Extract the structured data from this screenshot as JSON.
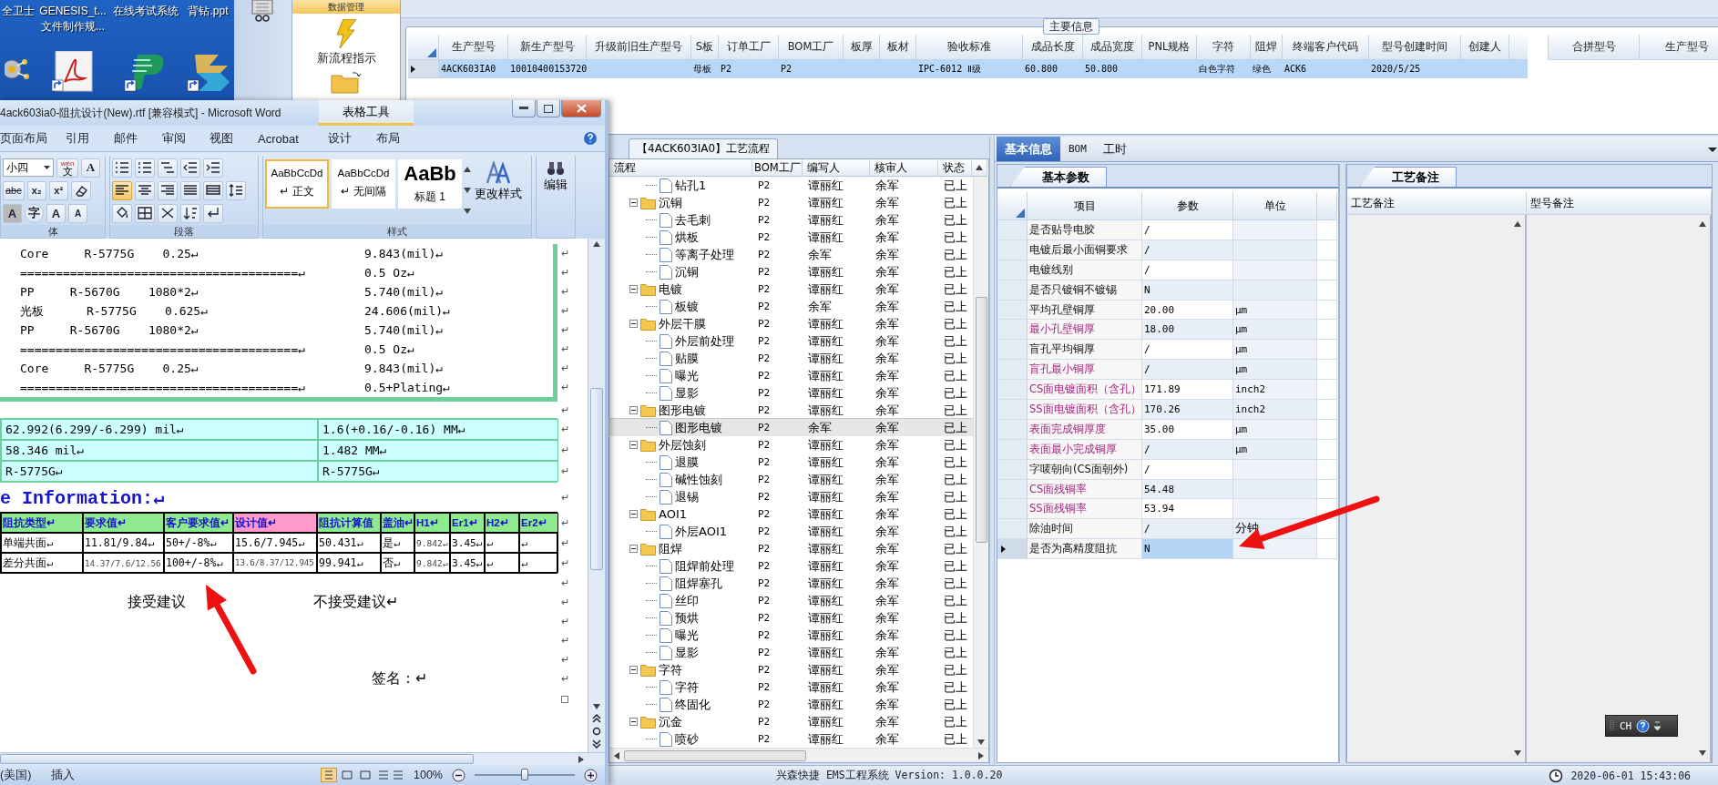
{
  "desktop": {
    "icons": [
      {
        "label_lines": [
          "全卫士"
        ],
        "kind": "gear"
      },
      {
        "label_lines": [
          "GENESIS_t...",
          "文件制作规..."
        ],
        "kind": "pdf"
      },
      {
        "label_lines": [
          "在线考试系统"
        ],
        "kind": "p"
      },
      {
        "label_lines": [
          "背钻.ppt"
        ],
        "kind": "chevrons"
      }
    ]
  },
  "app": {
    "nav": {
      "header": "数据管理",
      "items": [
        {
          "kind": "lightning",
          "label": "新流程指示"
        },
        {
          "kind": "folder"
        }
      ]
    },
    "main_info": {
      "title": "主要信息",
      "columns": [
        "生产型号",
        "新生产型号",
        "升级前旧生产型号",
        "S板",
        "订单工厂",
        "BOM工厂",
        "板厚",
        "板材",
        "验收标准",
        "成品长度",
        "成品宽度",
        "PNL规格",
        "字符",
        "阻焊",
        "终端客户代码",
        "型号创建时间",
        "创建人"
      ],
      "rows": [
        {
          "selected": true,
          "cells": [
            "4ACK603IA0",
            "10010400153720",
            null,
            "母板",
            "P2",
            "P2",
            null,
            null,
            "IPC-6012 Ⅱ级",
            "60.800",
            "50.800",
            null,
            "白色字符",
            "绿色",
            "ACK6",
            "2020/5/25",
            null
          ]
        }
      ],
      "side_columns": [
        "合拼型号",
        "生产型号"
      ]
    },
    "process": {
      "tab": "【4ACK603IA0】工艺流程",
      "columns": [
        "流程",
        "BOM工厂",
        "编写人",
        "核审人",
        "状态"
      ],
      "tree": [
        {
          "name": "钻孔1",
          "bom": "P2",
          "author": "谭丽红",
          "reviewer": "余军",
          "status": "已上",
          "selected": false
        },
        {
          "name": "沉铜",
          "bom": "P2",
          "author": "谭丽红",
          "reviewer": "余军",
          "status": "已上",
          "selected": false,
          "expanded": true,
          "children": [
            {
              "name": "去毛刺",
              "bom": "P2",
              "author": "谭丽红",
              "reviewer": "余军",
              "status": "已上",
              "selected": false
            },
            {
              "name": "烘板",
              "bom": "P2",
              "author": "谭丽红",
              "reviewer": "余军",
              "status": "已上",
              "selected": false
            },
            {
              "name": "等离子处理",
              "bom": "P2",
              "author": "余军",
              "reviewer": "余军",
              "status": "已上",
              "selected": false
            },
            {
              "name": "沉铜",
              "bom": "P2",
              "author": "谭丽红",
              "reviewer": "余军",
              "status": "已上",
              "selected": false
            }
          ]
        },
        {
          "name": "电镀",
          "bom": "P2",
          "author": "谭丽红",
          "reviewer": "余军",
          "status": "已上",
          "selected": false,
          "expanded": true,
          "children": [
            {
              "name": "板镀",
              "bom": "P2",
              "author": "余军",
              "reviewer": "余军",
              "status": "已上",
              "selected": false
            }
          ]
        },
        {
          "name": "外层干膜",
          "bom": "P2",
          "author": "谭丽红",
          "reviewer": "余军",
          "status": "已上",
          "selected": false,
          "expanded": true,
          "children": [
            {
              "name": "外层前处理",
              "bom": "P2",
              "author": "谭丽红",
              "reviewer": "余军",
              "status": "已上",
              "selected": false
            },
            {
              "name": "贴膜",
              "bom": "P2",
              "author": "谭丽红",
              "reviewer": "余军",
              "status": "已上",
              "selected": false
            },
            {
              "name": "曝光",
              "bom": "P2",
              "author": "谭丽红",
              "reviewer": "余军",
              "status": "已上",
              "selected": false
            },
            {
              "name": "显影",
              "bom": "P2",
              "author": "谭丽红",
              "reviewer": "余军",
              "status": "已上",
              "selected": false
            }
          ]
        },
        {
          "name": "图形电镀",
          "bom": "P2",
          "author": "谭丽红",
          "reviewer": "余军",
          "status": "已上",
          "selected": false,
          "expanded": true,
          "children": [
            {
              "name": "图形电镀",
              "bom": "P2",
              "author": "余军",
              "reviewer": "余军",
              "status": "已上",
              "selected": true
            }
          ]
        },
        {
          "name": "外层蚀刻",
          "bom": "P2",
          "author": "谭丽红",
          "reviewer": "余军",
          "status": "已上",
          "selected": false,
          "expanded": true,
          "children": [
            {
              "name": "退膜",
              "bom": "P2",
              "author": "谭丽红",
              "reviewer": "余军",
              "status": "已上",
              "selected": false
            },
            {
              "name": "碱性蚀刻",
              "bom": "P2",
              "author": "谭丽红",
              "reviewer": "余军",
              "status": "已上",
              "selected": false
            },
            {
              "name": "退锡",
              "bom": "P2",
              "author": "谭丽红",
              "reviewer": "余军",
              "status": "已上",
              "selected": false
            }
          ]
        },
        {
          "name": "AOI1",
          "bom": "P2",
          "author": "谭丽红",
          "reviewer": "余军",
          "status": "已上",
          "selected": false,
          "expanded": true,
          "children": [
            {
              "name": "外层AOI1",
              "bom": "P2",
              "author": "谭丽红",
              "reviewer": "余军",
              "status": "已上",
              "selected": false
            }
          ]
        },
        {
          "name": "阻焊",
          "bom": "P2",
          "author": "谭丽红",
          "reviewer": "余军",
          "status": "已上",
          "selected": false,
          "expanded": true,
          "children": [
            {
              "name": "阻焊前处理",
              "bom": "P2",
              "author": "谭丽红",
              "reviewer": "余军",
              "status": "已上",
              "selected": false
            },
            {
              "name": "阻焊塞孔",
              "bom": "P2",
              "author": "谭丽红",
              "reviewer": "余军",
              "status": "已上",
              "selected": false
            },
            {
              "name": "丝印",
              "bom": "P2",
              "author": "谭丽红",
              "reviewer": "余军",
              "status": "已上",
              "selected": false
            },
            {
              "name": "预烘",
              "bom": "P2",
              "author": "谭丽红",
              "reviewer": "余军",
              "status": "已上",
              "selected": false
            },
            {
              "name": "曝光",
              "bom": "P2",
              "author": "谭丽红",
              "reviewer": "余军",
              "status": "已上",
              "selected": false
            },
            {
              "name": "显影",
              "bom": "P2",
              "author": "谭丽红",
              "reviewer": "余军",
              "status": "已上",
              "selected": false
            }
          ]
        },
        {
          "name": "字符",
          "bom": "P2",
          "author": "谭丽红",
          "reviewer": "余军",
          "status": "已上",
          "selected": false,
          "expanded": true,
          "children": [
            {
              "name": "字符",
              "bom": "P2",
              "author": "谭丽红",
              "reviewer": "余军",
              "status": "已上",
              "selected": false
            },
            {
              "name": "终固化",
              "bom": "P2",
              "author": "谭丽红",
              "reviewer": "余军",
              "status": "已上",
              "selected": false
            }
          ]
        },
        {
          "name": "沉金",
          "bom": "P2",
          "author": "谭丽红",
          "reviewer": "余军",
          "status": "已上",
          "selected": false,
          "expanded": true,
          "children": [
            {
              "name": "喷砂",
              "bom": "P2",
              "author": "谭丽红",
              "reviewer": "余军",
              "status": "已上",
              "selected": false
            }
          ]
        }
      ]
    },
    "details": {
      "tabs": [
        {
          "label": "基本信息",
          "selected": true
        },
        {
          "label": "BOM",
          "selected": false
        },
        {
          "label": "工时",
          "selected": false
        }
      ],
      "params": {
        "tab": "基本参数",
        "columns": [
          "项目",
          "参数",
          "单位"
        ],
        "rows": [
          {
            "item": "是否贴导电胶",
            "value": "/",
            "highlighted": false,
            "selected": false
          },
          {
            "item": "电镀后最小面铜要求",
            "value": "/",
            "highlighted": false,
            "selected": false
          },
          {
            "item": "电镀线别",
            "value": "/",
            "highlighted": false,
            "selected": false
          },
          {
            "item": "是否只镀铜不镀锡",
            "value": "N",
            "highlighted": false,
            "selected": false
          },
          {
            "item": "平均孔壁铜厚",
            "value": "20.00",
            "unit": "µm",
            "highlighted": false,
            "selected": false
          },
          {
            "item": "最小孔壁铜厚",
            "value": "18.00",
            "unit": "µm",
            "highlighted": true,
            "selected": false
          },
          {
            "item": "盲孔平均铜厚",
            "value": "/",
            "unit": "µm",
            "highlighted": false,
            "selected": false
          },
          {
            "item": "盲孔最小铜厚",
            "value": "/",
            "unit": "µm",
            "highlighted": true,
            "selected": false
          },
          {
            "item": "CS面电镀面积（含孔）",
            "value": "171.89",
            "unit": "inch2",
            "highlighted": true,
            "selected": false
          },
          {
            "item": "SS面电镀面积（含孔）",
            "value": "170.26",
            "unit": "inch2",
            "highlighted": true,
            "selected": false
          },
          {
            "item": "表面完成铜厚度",
            "value": "35.00",
            "unit": "µm",
            "highlighted": true,
            "selected": false
          },
          {
            "item": "表面最小完成铜厚",
            "value": "/",
            "unit": "µm",
            "highlighted": true,
            "selected": false
          },
          {
            "item": "字唛朝向(CS面朝外)",
            "value": "/",
            "highlighted": false,
            "selected": false
          },
          {
            "item": "CS面残铜率",
            "value": "54.48",
            "highlighted": true,
            "selected": false
          },
          {
            "item": "SS面残铜率",
            "value": "53.94",
            "highlighted": true,
            "selected": false
          },
          {
            "item": "除油时间",
            "value": "/",
            "unit": "分钟",
            "highlighted": false,
            "selected": false
          },
          {
            "item": "是否为高精度阻抗",
            "value": "N",
            "highlighted": false,
            "selected": true
          }
        ]
      },
      "notes": {
        "tab": "工艺备注",
        "columns": [
          "工艺备注",
          "型号备注"
        ]
      }
    },
    "status_bar": {
      "text": "兴森快捷 EMS工程系统 Version: 1.0.0.20",
      "datetime": "2020-06-01 15:43:06"
    }
  },
  "language_bar": {
    "label": "CH"
  },
  "word": {
    "title": "4ack603ia0-阻抗设计(New).rtf [兼容模式] - Microsoft Word",
    "context_tab": "表格工具",
    "menu_tabs": [
      "页面布局",
      "引用",
      "邮件",
      "审阅",
      "视图",
      "Acrobat",
      "设计",
      "布局"
    ],
    "ribbon": {
      "font_size": "小四",
      "phonetic": [
        "wén",
        "文"
      ],
      "border_letter": "A",
      "font_row2": [
        {
          "kind": "strike",
          "text": "abc"
        },
        {
          "kind": "sub",
          "text": "x₂"
        },
        {
          "kind": "sup",
          "text": "x²"
        }
      ],
      "font_row3": [
        {
          "kind": "shade",
          "text": "A"
        },
        {
          "kind": "enclose",
          "text": "字"
        },
        {
          "kind": "grow",
          "text": "A"
        },
        {
          "kind": "shrink",
          "text": "A"
        }
      ],
      "align_buttons": [
        {
          "kind": "left",
          "selected": true
        },
        {
          "kind": "center",
          "selected": false
        },
        {
          "kind": "right",
          "selected": false
        },
        {
          "kind": "justify",
          "selected": false
        },
        {
          "kind": "distributed",
          "selected": false
        }
      ],
      "styles": [
        {
          "sample": "AaBbCcDd",
          "name": "↵ 正文",
          "selected": true,
          "kind": "normal"
        },
        {
          "sample": "AaBbCcDd",
          "name": "↵ 无间隔",
          "selected": false,
          "kind": "normal"
        },
        {
          "sample": "AaBb",
          "name": "标题 1",
          "selected": false,
          "kind": "heading"
        }
      ],
      "change_styles": "更改样式",
      "edit": "编辑",
      "group_labels": [
        "体",
        "段落",
        "样式"
      ]
    },
    "document": {
      "stackup": [
        {
          "left": "Core     R-5775G    0.25↵",
          "right": "9.843(mil)↵",
          "end": "↵"
        },
        {
          "left": "=======================================↵",
          "right": "0.5 Oz↵",
          "end": "↵"
        },
        {
          "left": "PP     R-5670G    1080*2↵",
          "right": "5.740(mil)↵",
          "end": "↵"
        },
        {
          "left": "光板      R-5775G    0.625↵",
          "right": "24.606(mil)↵",
          "end": "↵"
        },
        {
          "left": "PP     R-5670G    1080*2↵",
          "right": "5.740(mil)↵",
          "end": "↵"
        },
        {
          "left": "=======================================↵",
          "right": "0.5 Oz↵",
          "end": "↵"
        },
        {
          "left": "Core     R-5775G    0.25↵",
          "right": "9.843(mil)↵",
          "end": "↵"
        },
        {
          "left": "=======================================↵",
          "right": "0.5+Plating↵",
          "end": "↵"
        }
      ],
      "gap_mark": "↵",
      "summary_rows": [
        {
          "cells": [
            "62.992(6.299/-6.299) mil↵",
            "1.6(+0.16/-0.16) MM↵"
          ],
          "end": "↵"
        },
        {
          "cells": [
            "58.346 mil↵",
            "1.482 MM↵"
          ],
          "end": "↵"
        },
        {
          "cells": [
            "R-5775G↵",
            "R-5775G↵"
          ],
          "end": "↵"
        }
      ],
      "heading": {
        "text": "e Information:↵",
        "end": "↵"
      },
      "impedance": {
        "columns": [
          {
            "label": "阻抗类型↵",
            "color": "#8fea8f"
          },
          {
            "label": "要求值↵",
            "color": "#8fea8f"
          },
          {
            "label": "客户要求值↵",
            "color": "#8fea8f"
          },
          {
            "label": "设计值↵",
            "color": "#ff99cc"
          },
          {
            "label": "阻抗计算值",
            "color": "#8fea8f"
          },
          {
            "label": "盖油↵",
            "color": "#8fea8f"
          },
          {
            "label": "H1↵",
            "color": "#8fea8f"
          },
          {
            "label": "Er1↵",
            "color": "#8fea8f"
          },
          {
            "label": "H2↵",
            "color": "#8fea8f"
          },
          {
            "label": "Er2↵",
            "color": "#8fea8f"
          }
        ],
        "header_end": "↵",
        "rows": [
          {
            "cells": [
              "单端共面↵",
              "11.81/9.84↵",
              "50+/-8%↵",
              "15.6/7.945↵",
              "50.431↵",
              "是↵",
              "9.842↵",
              "3.45↵",
              "↵",
              "↵"
            ],
            "end": "↵"
          },
          {
            "cells": [
              "差分共面↵",
              "14.37/7.6/12.56",
              "100+/-8%↵",
              "13.6/8.37/12.945",
              "99.941↵",
              "否↵",
              "9.842↵",
              "3.45↵",
              "↵",
              "↵"
            ],
            "end": "↵"
          }
        ]
      },
      "closing_lines": [
        {
          "kind": "blank",
          "end": "↵"
        },
        {
          "kind": "choice",
          "left": "接受建议",
          "right": "不接受建议↵",
          "end": "↵"
        },
        {
          "kind": "blank",
          "end": "↵"
        },
        {
          "kind": "blank",
          "end": "↵"
        },
        {
          "kind": "blank",
          "end": "↵"
        },
        {
          "kind": "sign",
          "text": "签名：↵",
          "end": "↵"
        },
        {
          "kind": "cell_end"
        }
      ]
    },
    "status": {
      "language": "(美国)",
      "mode": "插入",
      "zoom": "100%",
      "zoom_slider": {
        "level": 0.5
      }
    }
  },
  "annotations": [
    {
      "kind": "arrow"
    },
    {
      "kind": "arrow"
    }
  ]
}
